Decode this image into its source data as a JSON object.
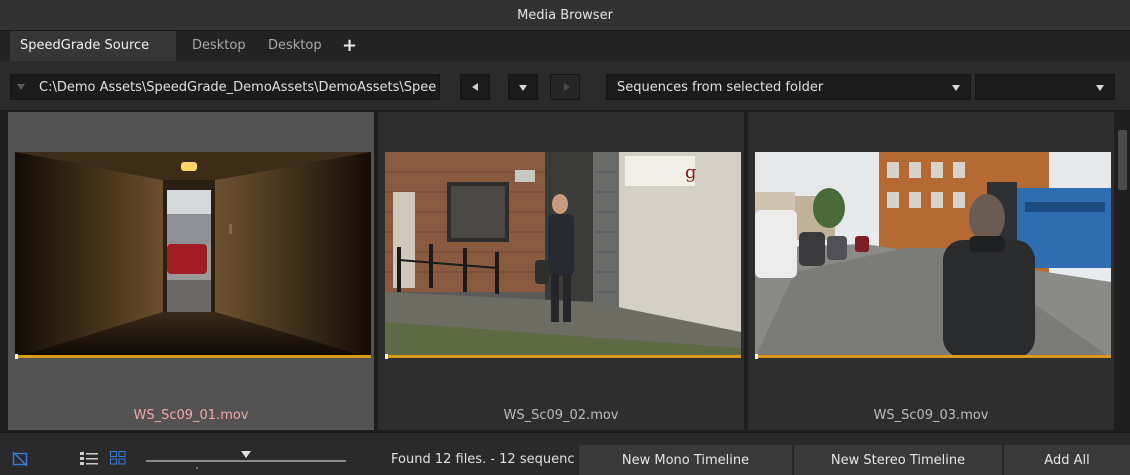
{
  "window": {
    "title": "Media Browser"
  },
  "tabs": [
    {
      "label": "SpeedGrade Source",
      "active": true
    },
    {
      "label": "Desktop",
      "active": false
    },
    {
      "label": "Desktop",
      "active": false
    }
  ],
  "add_tab_symbol": "+",
  "toolbar": {
    "path": "C:\\Demo Assets\\SpeedGrade_DemoAssets\\DemoAssets\\Spee",
    "filter_selected": "Sequences from selected folder",
    "secondary_selected": ""
  },
  "media": [
    {
      "name": "WS_Sc09_01.mov",
      "selected": true,
      "progress": 0.0
    },
    {
      "name": "WS_Sc09_02.mov",
      "selected": false,
      "progress": 0.0
    },
    {
      "name": "WS_Sc09_03.mov",
      "selected": false,
      "progress": 0.0
    }
  ],
  "status": {
    "found_text": "Found 12 files. - 12 sequenc",
    "thumbnail_size_fraction": 0.5
  },
  "buttons": {
    "new_mono": "New Mono Timeline",
    "new_stereo": "New Stereo Timeline",
    "add_all": "Add All"
  },
  "colors": {
    "progress_bar": "#d99a1a",
    "selected_card": "#535353",
    "selected_name": "#f3a8a8",
    "view_icon_active": "#3a7ad8"
  },
  "icons": {
    "filter": "filter-off-icon",
    "list_view": "list-view-icon",
    "grid_view": "grid-view-icon"
  }
}
